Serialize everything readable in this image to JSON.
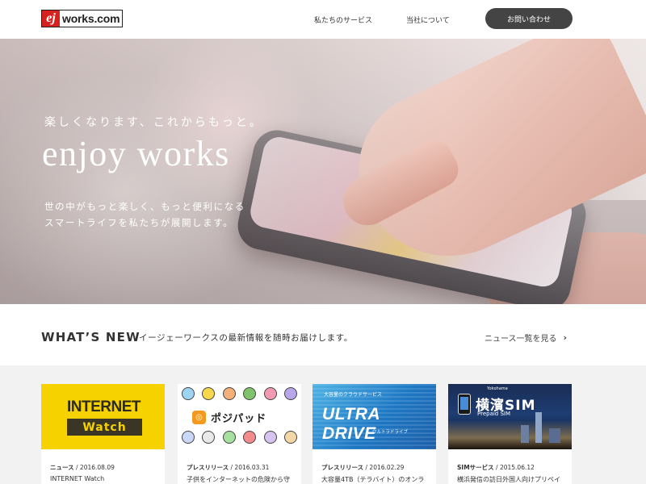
{
  "header": {
    "logo_mark": "ej",
    "logo_text": "works.com",
    "nav": {
      "services": "私たちのサービス",
      "about": "当社について"
    },
    "contact_label": "お問い合わせ"
  },
  "hero": {
    "tagline": "楽しくなります、これからもっと。",
    "title": "enjoy works",
    "desc_line1": "世の中がもっと楽しく、もっと便利になる",
    "desc_line2": "スマートライフを私たちが展開します。"
  },
  "whats_new": {
    "title": "WHAT’S NEW",
    "subtitle": "イージェーワークスの最新情報を随時お届けします。",
    "more_label": "ニュース一覧を見る",
    "more_icon": "chevron-right-icon"
  },
  "cards": [
    {
      "category": "ニュース",
      "date": "2016.08.09",
      "text": "INTERNET Watch",
      "thumb": {
        "line1": "INTERNET",
        "line2": "Watch"
      }
    },
    {
      "category": "プレスリリース",
      "date": "2016.03.31",
      "text": "子供をインターネットの危険から守",
      "thumb": {
        "name": "ポジパッド"
      }
    },
    {
      "category": "プレスリリース",
      "date": "2016.02.29",
      "text": "大容量4TB（テラバイト）のオンラ",
      "thumb": {
        "sub": "大容量のクラウドサービス",
        "main": "ULTRA DRIVE",
        "kana": "ウルトラドライブ"
      }
    },
    {
      "category": "SIMサービス",
      "date": "2015.06.12",
      "text": "横浜発信の訪日外国人向けプリペイ",
      "thumb": {
        "yoko": "Yokohama",
        "title": "横濱SIM",
        "sub": "Prepaid SIM"
      }
    }
  ],
  "colors": {
    "brand_red": "#d7231f",
    "contact_button": "#444444",
    "internet_watch_yellow": "#f6d200",
    "ultra_drive_blue": "#1e78c4"
  }
}
